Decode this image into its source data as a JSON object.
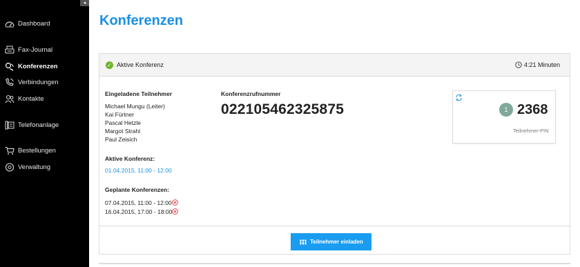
{
  "sidebar": {
    "collapse_glyph": "◂",
    "items": [
      {
        "label": "Dashboard",
        "icon": "dashboard-icon"
      },
      {
        "label": "Fax-Journal",
        "icon": "fax-icon"
      },
      {
        "label": "Konferenzen",
        "icon": "conference-icon",
        "active": true
      },
      {
        "label": "Verbindungen",
        "icon": "phone-icon"
      },
      {
        "label": "Kontakte",
        "icon": "contacts-icon"
      },
      {
        "label": "Telefonanlage",
        "icon": "phone-system-icon"
      },
      {
        "label": "Bestellungen",
        "icon": "cart-icon"
      },
      {
        "label": "Verwaltung",
        "icon": "settings-icon"
      }
    ]
  },
  "page": {
    "title": "Konferenzen"
  },
  "panel": {
    "status": "Aktive Konferenz",
    "duration": "4:21 Minuten",
    "participants_label": "Eingeladene Teilnehmer",
    "participants": [
      "Michael Mungu (Leiter)",
      "Kai Fürtner",
      "Pascal Hetzle",
      "Margot Strahl",
      "Paul Zeisich"
    ],
    "active_label": "Aktive Konferenz:",
    "active_value": "01.04.2015, 11:00 - 12:00",
    "planned_label": "Geplante Konferenzen:",
    "planned": [
      "07.04.2015, 11:00 - 12:00",
      "16.04.2015, 17:00 - 18:00"
    ],
    "number_label": "Konferenzrufnummer",
    "number": "022105462325875",
    "pin_card": {
      "count": "1",
      "pin": "2368",
      "pin_label": "Teilnehmer-PIN"
    },
    "invite_label": "Teilnehmer einladen"
  },
  "colors": {
    "accent": "#1a8fe3",
    "sidebar_bg": "#000000",
    "success": "#6fb52c",
    "danger": "#e0393e",
    "badge": "#7fa99b"
  }
}
